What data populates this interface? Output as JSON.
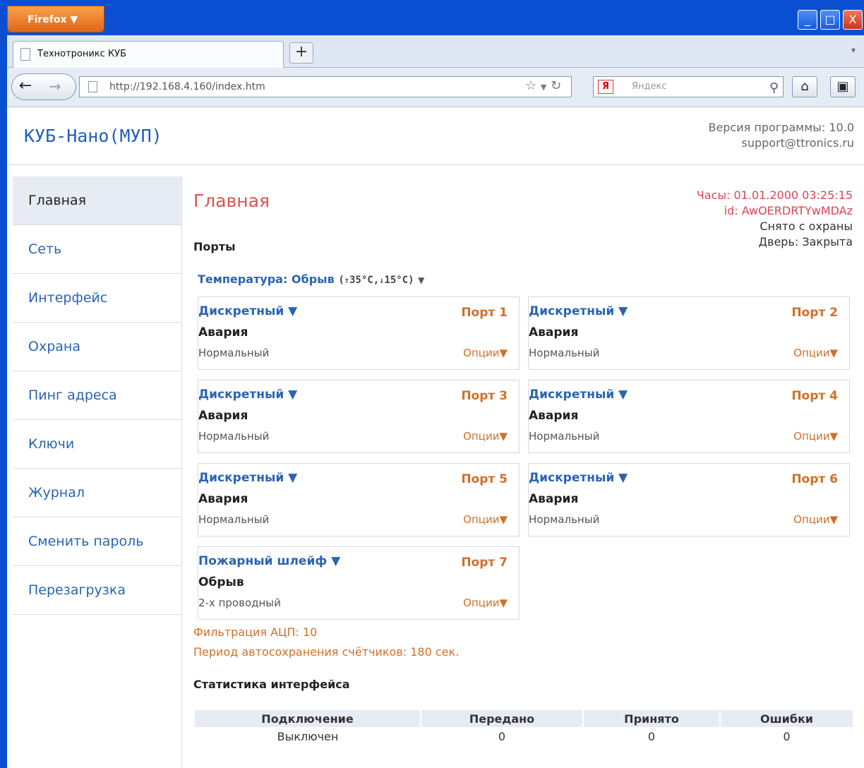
{
  "browser": {
    "menu_button": "Firefox ▼",
    "tab_title": "Технотроникс КУБ",
    "new_tab": "+",
    "url": "http://192.168.4.160/index.htm",
    "search_placeholder": "Яндекс",
    "search_engine_icon": "Я",
    "window_controls": [
      "_",
      "□",
      "X"
    ]
  },
  "header": {
    "app_title": "КУБ-Нано(МУП)",
    "version": "Версия программы: 10.0",
    "support": "support@ttronics.ru"
  },
  "sidebar": {
    "items": [
      {
        "label": "Главная"
      },
      {
        "label": "Сеть"
      },
      {
        "label": "Интерфейс"
      },
      {
        "label": "Охрана"
      },
      {
        "label": "Пинг адреса"
      },
      {
        "label": "Ключи"
      },
      {
        "label": "Журнал"
      },
      {
        "label": "Сменить пароль"
      },
      {
        "label": "Перезагрузка"
      }
    ]
  },
  "main": {
    "title": "Главная",
    "clock": "Часы: 01.01.2000 03:25:15",
    "device_id": "id: AwOERDRTYwMDAz",
    "arm_status": "Снято с охраны",
    "door_status": "Дверь: Закрыта",
    "ports_heading": "Порты",
    "temperature": {
      "label": "Температура: Обрыв",
      "high": "35°C",
      "low": "15°C"
    },
    "ports": [
      {
        "type": "Дискретный ▼",
        "num": "Порт 1",
        "state": "Авария",
        "mode": "Нормальный",
        "options": "Опции▼"
      },
      {
        "type": "Дискретный ▼",
        "num": "Порт 2",
        "state": "Авария",
        "mode": "Нормальный",
        "options": "Опции▼"
      },
      {
        "type": "Дискретный ▼",
        "num": "Порт 3",
        "state": "Авария",
        "mode": "Нормальный",
        "options": "Опции▼"
      },
      {
        "type": "Дискретный ▼",
        "num": "Порт 4",
        "state": "Авария",
        "mode": "Нормальный",
        "options": "Опции▼"
      },
      {
        "type": "Дискретный ▼",
        "num": "Порт 5",
        "state": "Авария",
        "mode": "Нормальный",
        "options": "Опции▼"
      },
      {
        "type": "Дискретный ▼",
        "num": "Порт 6",
        "state": "Авария",
        "mode": "Нормальный",
        "options": "Опции▼"
      },
      {
        "type": "Пожарный шлейф ▼",
        "num": "Порт 7",
        "state": "Обрыв",
        "mode": "2-х проводный",
        "options": "Опции▼"
      }
    ],
    "adc_filter": "Фильтрация АЦП: 10",
    "autosave": "Период автосохранения счётчиков: 180 сек.",
    "stats_heading": "Статистика интерфейса",
    "stats": {
      "headers": [
        "Подключение",
        "Передано",
        "Принято",
        "Ошибки"
      ],
      "row": [
        "Выключен",
        "0",
        "0",
        "0"
      ]
    }
  }
}
